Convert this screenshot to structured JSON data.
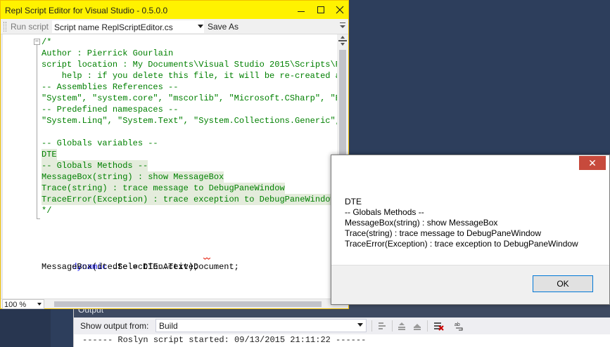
{
  "editor": {
    "title": "Repl Script Editor for Visual Studio - 0.5.0.0",
    "toolbar": {
      "run_label": "Run script",
      "script_name": "Script name ReplScriptEditor.cs",
      "save_as_label": "Save As"
    },
    "code_lines": [
      "/*",
      "Author : Pierrick Gourlain",
      "script location : My Documents\\Visual Studio 2015\\Scripts\\Re",
      "    help : if you delete this file, it will be re-created af",
      "-- Assemblies References --",
      "\"System\", \"system.core\", \"mscorlib\", \"Microsoft.CSharp\", \"En",
      "-- Predefined namespaces --",
      "\"System.Linq\", \"System.Text\", \"System.Collections.Generic\",",
      "",
      "-- Globals variables --",
      "DTE",
      "-- Globals Methods --",
      "MessageBox(string) : show MessageBox",
      "Trace(string) : trace message to DebugPaneWindow",
      "TraceError(Exception) : trace exception to DebugPaneWindow",
      "*/"
    ],
    "code_keyword": "dynamic",
    "code_stmt1_rest": " dte = DTE.ActiveDocument;",
    "code_stmt2": "MessageBox(dte.Selection.Text);",
    "zoom": "100 %"
  },
  "output": {
    "title": "Output",
    "show_output_label": "Show output from:",
    "source": "Build",
    "text": "------ Roslyn script started: 09/13/2015 21:11:22 ------"
  },
  "messagebox": {
    "lines": [
      "DTE",
      "-- Globals Methods --",
      "MessageBox(string) : show MessageBox",
      "Trace(string) : trace message to DebugPaneWindow",
      "TraceError(Exception) : trace exception to DebugPaneWindow"
    ],
    "ok_label": "OK",
    "close_glyph": "✕"
  },
  "colors": {
    "title_bar": "#fff200",
    "comment": "#008000",
    "keyword": "#0000ff",
    "selection": "#e4ecdc",
    "close_button": "#c74a3c"
  }
}
